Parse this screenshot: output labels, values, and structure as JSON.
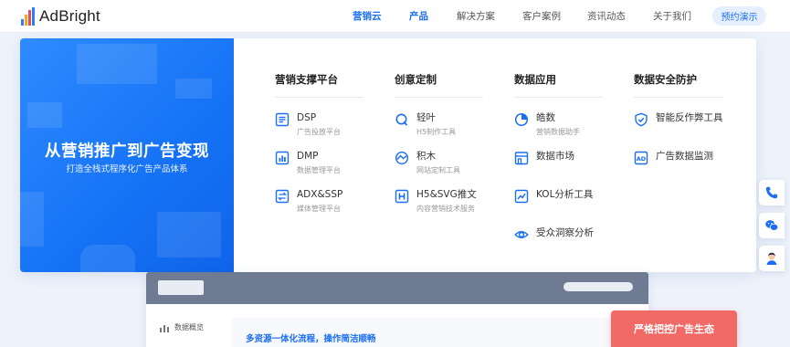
{
  "brand": {
    "name": "AdBright",
    "accent": "#1b6ef3",
    "cta_red": "#f26a66"
  },
  "nav": {
    "items": [
      {
        "label": "营销云",
        "active": true
      },
      {
        "label": "产品",
        "active": true
      },
      {
        "label": "解决方案",
        "active": false
      },
      {
        "label": "客户案例",
        "active": false
      },
      {
        "label": "资讯动态",
        "active": false
      },
      {
        "label": "关于我们",
        "active": false
      }
    ],
    "cta": "预约演示"
  },
  "hero": {
    "title": "从营销推广到广告变现",
    "subtitle": "打造全栈式程序化广告产品体系"
  },
  "columns": [
    {
      "heading": "营销支撑平台",
      "items": [
        {
          "icon": "list-icon",
          "title": "DSP",
          "desc": "广告投放平台"
        },
        {
          "icon": "bar-chart-icon",
          "title": "DMP",
          "desc": "数据管理平台"
        },
        {
          "icon": "exchange-icon",
          "title": "ADX&SSP",
          "desc": "媒体管理平台"
        }
      ]
    },
    {
      "heading": "创意定制",
      "items": [
        {
          "icon": "search-q-icon",
          "title": "轻叶",
          "desc": "H5制作工具"
        },
        {
          "icon": "cube-icon",
          "title": "积木",
          "desc": "网站定制工具"
        },
        {
          "icon": "h-box-icon",
          "title": "H5&SVG推文",
          "desc": "内容营销技术服务"
        }
      ]
    },
    {
      "heading": "数据应用",
      "items": [
        {
          "icon": "pie-chart-icon",
          "title": "皓数",
          "desc": "营销数据助手"
        },
        {
          "icon": "store-icon",
          "title": "数据市场",
          "desc": ""
        },
        {
          "icon": "trend-icon",
          "title": "KOL分析工具",
          "desc": ""
        },
        {
          "icon": "eye-icon",
          "title": "受众洞察分析",
          "desc": ""
        }
      ]
    },
    {
      "heading": "数据安全防护",
      "items": [
        {
          "icon": "shield-check-icon",
          "title": "智能反作弊工具",
          "desc": ""
        },
        {
          "icon": "ad-monitor-icon",
          "title": "广告数据监测",
          "desc": ""
        }
      ]
    }
  ],
  "float_bar": [
    {
      "icon": "phone-icon"
    },
    {
      "icon": "wechat-icon"
    },
    {
      "icon": "agent-avatar-icon"
    }
  ],
  "preview": {
    "side_label": "数据概览",
    "panel_text": "多资源一体化流程，操作简洁顺畅"
  },
  "red_cta": "严格把控广告生态"
}
